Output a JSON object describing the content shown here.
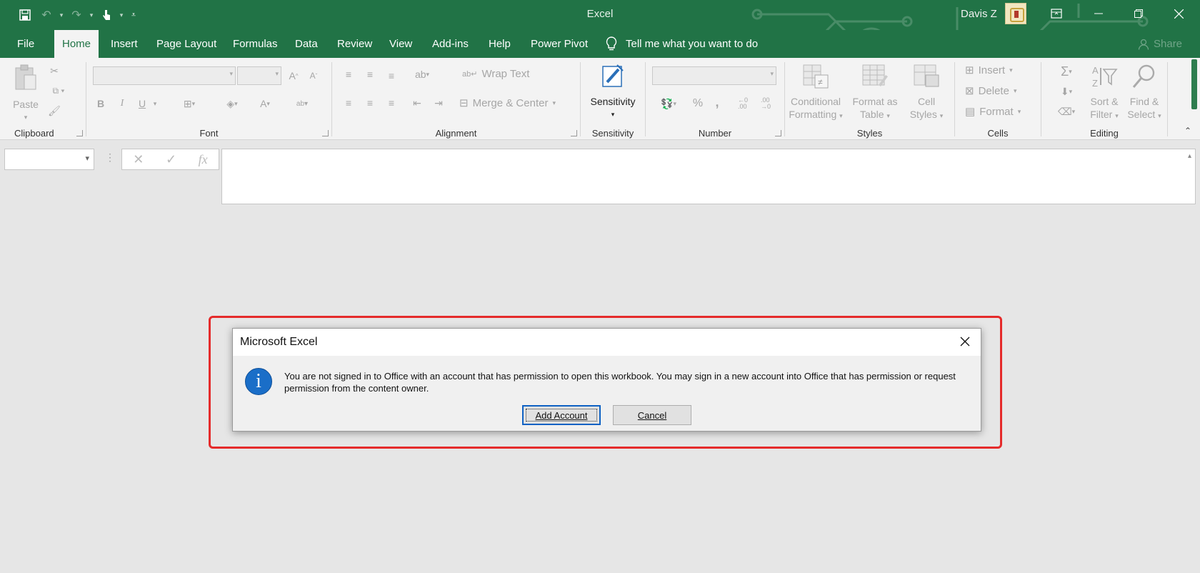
{
  "window": {
    "title": "Excel",
    "user_name": "Davis Z",
    "share_label": "Share"
  },
  "menu": {
    "tabs": [
      "File",
      "Home",
      "Insert",
      "Page Layout",
      "Formulas",
      "Data",
      "Review",
      "View",
      "Add-ins",
      "Help",
      "Power Pivot"
    ],
    "active_tab": "Home",
    "tell_me": "Tell me what you want to do"
  },
  "ribbon": {
    "clipboard": {
      "label": "Clipboard",
      "paste": "Paste"
    },
    "font": {
      "label": "Font",
      "bold": "B",
      "italic": "I",
      "underline": "U"
    },
    "alignment": {
      "label": "Alignment",
      "wrap_text": "Wrap Text",
      "merge_center": "Merge & Center"
    },
    "sensitivity": {
      "label": "Sensitivity",
      "button": "Sensitivity"
    },
    "number": {
      "label": "Number",
      "percent": "%",
      "comma": ","
    },
    "styles": {
      "label": "Styles",
      "conditional_1": "Conditional",
      "conditional_2": "Formatting",
      "format_table_1": "Format as",
      "format_table_2": "Table",
      "cell_styles_1": "Cell",
      "cell_styles_2": "Styles"
    },
    "cells": {
      "label": "Cells",
      "insert": "Insert",
      "delete": "Delete",
      "format": "Format"
    },
    "editing": {
      "label": "Editing",
      "sort_1": "Sort &",
      "sort_2": "Filter",
      "find_1": "Find &",
      "find_2": "Select"
    }
  },
  "formula_bar": {
    "fx": "fx"
  },
  "dialog": {
    "title": "Microsoft Excel",
    "message": "You are not signed in to Office with an account that has permission to open this workbook. You may sign in a new account into Office that has permission or request permission from the content owner.",
    "primary_button": "Add Account",
    "secondary_button": "Cancel"
  },
  "colors": {
    "excel_green": "#217346",
    "highlight_red": "#e52b2b",
    "info_blue": "#1a6ec8"
  }
}
